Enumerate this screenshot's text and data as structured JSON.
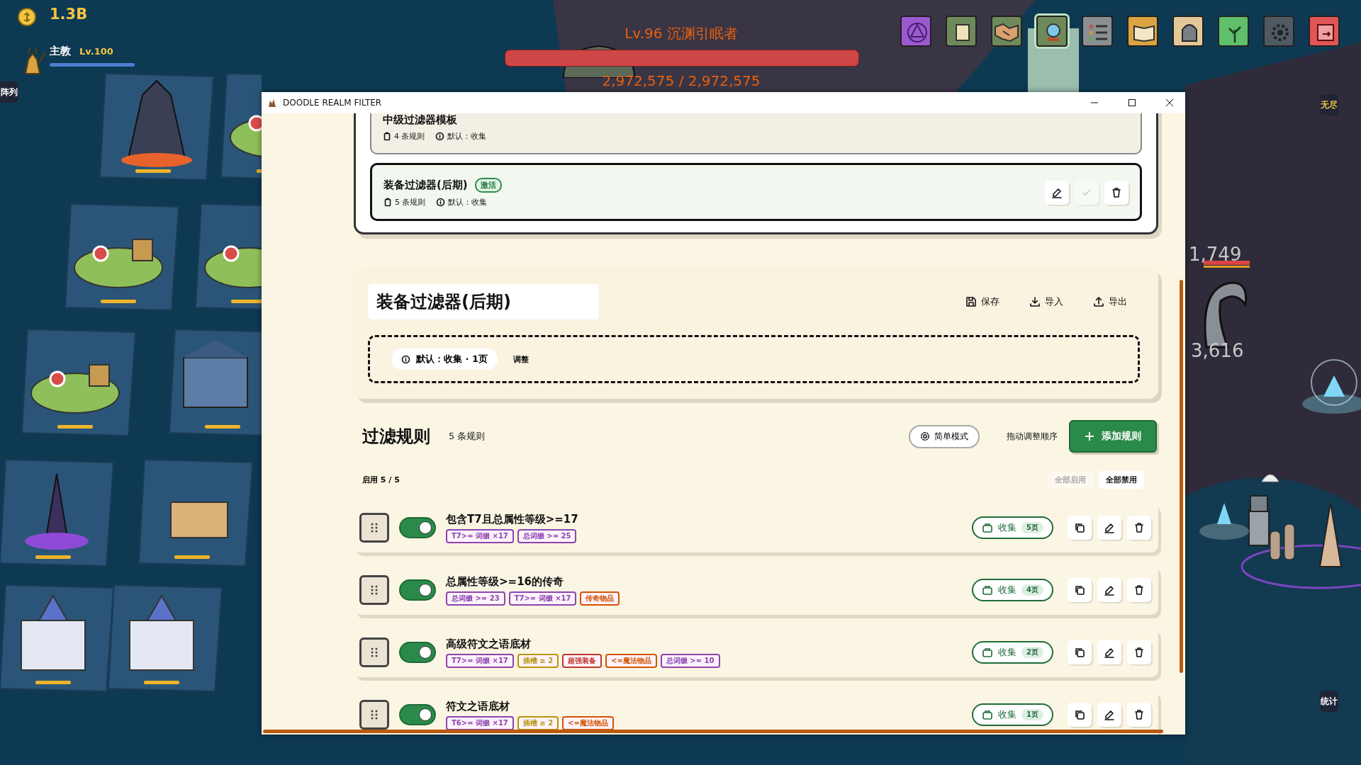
{
  "hud": {
    "gold": "1.3B",
    "hero": {
      "name": "主教",
      "level_text": "Lv.100",
      "level": 1
    }
  },
  "boss": {
    "title": "Lv.96 沉渊引眠者",
    "hp": "2,972,575 / 2,972,575",
    "level": 1
  },
  "toolbar": [
    {
      "kind": "rune"
    },
    {
      "kind": "scroll"
    },
    {
      "kind": "handshake"
    },
    {
      "kind": "orb",
      "selected": true
    },
    {
      "kind": "list"
    },
    {
      "kind": "book"
    },
    {
      "kind": "helmet"
    },
    {
      "kind": "tree"
    },
    {
      "kind": "gear"
    },
    {
      "kind": "save"
    }
  ],
  "side_tabs": [
    {
      "label": "阵列",
      "selected": false
    },
    {
      "label": "无尽",
      "selected": true
    },
    {
      "label": "统计",
      "selected": false
    }
  ],
  "damage_numbers": [
    "1,749",
    "3,616"
  ],
  "window": {
    "title": "DOODLE REALM FILTER"
  },
  "filters": [
    {
      "name": "中级过滤器模板",
      "rules": "4 条规则",
      "default": "默认：收集",
      "active": false
    },
    {
      "name": "装备过滤器(后期)",
      "badge": "激活",
      "rules": "5 条规则",
      "default": "默认：收集",
      "active": true
    }
  ],
  "editor": {
    "name": "装备过滤器(后期)",
    "actions": [
      {
        "kind": "save",
        "label": "保存"
      },
      {
        "kind": "import",
        "label": "导入"
      },
      {
        "kind": "export",
        "label": "导出"
      }
    ],
    "default_chip": "默认：收集 · 1页",
    "adjust": "调整"
  },
  "rules_header": {
    "title": "过滤规则",
    "count": "5 条规则",
    "mode": "简单模式",
    "drag_hint": "拖动调整顺序",
    "add": "添加规则",
    "enabled": "启用 5 / 5",
    "enable_all": {
      "label": "全部启用",
      "disabled": true
    },
    "disable_all": {
      "label": "全部禁用",
      "disabled": false
    }
  },
  "rules": [
    {
      "name": "包含T7且总属性等级>=17",
      "on": true,
      "action": "收集",
      "pages": "5页",
      "tags": [
        {
          "text": "T7>= 词缀 ×17",
          "color": "#8e44ad"
        },
        {
          "text": "总词缀 >= 25",
          "color": "#8e44ad"
        }
      ]
    },
    {
      "name": "总属性等级>=16的传奇",
      "on": true,
      "action": "收集",
      "pages": "4页",
      "tags": [
        {
          "text": "总词缀 >= 23",
          "color": "#8e44ad"
        },
        {
          "text": "T7>= 词缀 ×17",
          "color": "#8e44ad"
        },
        {
          "text": "传奇物品",
          "color": "#d35400"
        }
      ]
    },
    {
      "name": "高级符文之语底材",
      "on": true,
      "action": "收集",
      "pages": "2页",
      "tags": [
        {
          "text": "T7>= 词缀 ×17",
          "color": "#8e44ad"
        },
        {
          "text": "插槽 ≥ 2",
          "color": "#b7950b"
        },
        {
          "text": "超强装备",
          "color": "#c0392b"
        },
        {
          "text": "<=魔法物品",
          "color": "#d35400"
        },
        {
          "text": "总词缀 >= 10",
          "color": "#8e44ad"
        }
      ]
    },
    {
      "name": "符文之语底材",
      "on": true,
      "action": "收集",
      "pages": "1页",
      "tags": [
        {
          "text": "T6>= 词缀 ×17",
          "color": "#8e44ad"
        },
        {
          "text": "插槽 ≥ 2",
          "color": "#b7950b"
        },
        {
          "text": "<=魔法物品",
          "color": "#d35400"
        }
      ]
    }
  ]
}
